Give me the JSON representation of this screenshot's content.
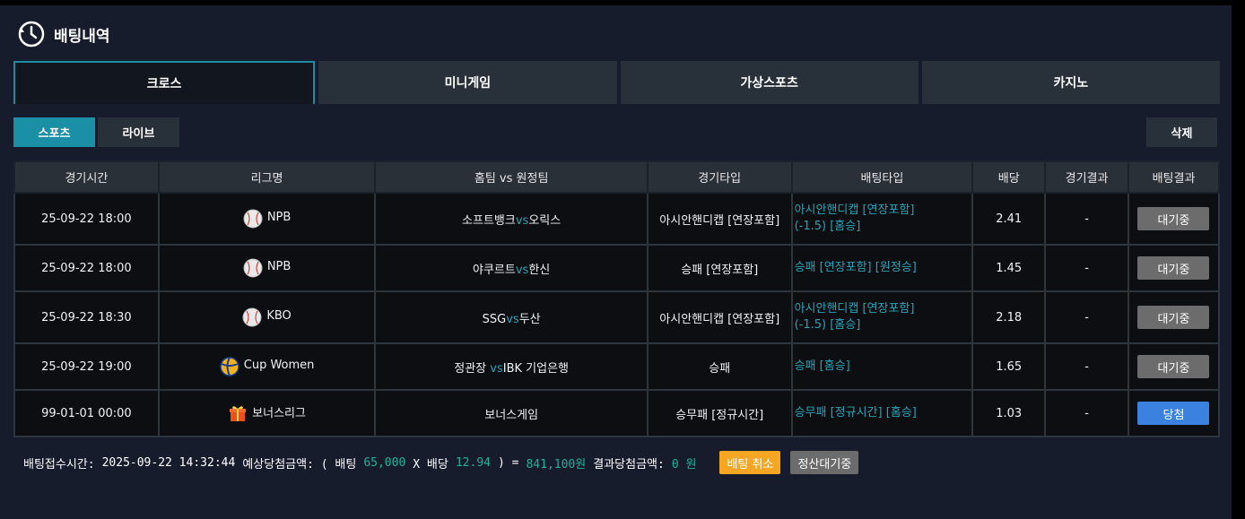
{
  "header": {
    "title": "배팅내역",
    "icon": "history-clock-icon"
  },
  "tabs": [
    {
      "label": "크로스",
      "active": true
    },
    {
      "label": "미니게임",
      "active": false
    },
    {
      "label": "가상스포츠",
      "active": false
    },
    {
      "label": "카지노",
      "active": false
    }
  ],
  "subtabs": [
    {
      "label": "스포츠",
      "active": true
    },
    {
      "label": "라이브",
      "active": false
    }
  ],
  "delete_label": "삭제",
  "columns": [
    "경기시간",
    "리그명",
    "홈팀 vs 원정팀",
    "경기타입",
    "배팅타입",
    "배당",
    "경기결과",
    "배팅결과"
  ],
  "rows": [
    {
      "time": "25-09-22 18:00",
      "league_icon": "baseball-icon",
      "league": "NPB",
      "home": "소프트뱅크",
      "vs": "vs",
      "away": "오릭스",
      "game_type": "아시안핸디캡 [연장포함]",
      "bet_type_1": "아시안핸디캡 [연장포함]",
      "bet_type_2": "(-1.5) [홈승]",
      "odds": "2.41",
      "result": "-",
      "status": "대기중"
    },
    {
      "time": "25-09-22 18:00",
      "league_icon": "baseball-icon",
      "league": "NPB",
      "home": "야쿠르트",
      "vs": "vs",
      "away": "한신",
      "game_type": "승패 [연장포함]",
      "bet_type_1": "승패 [연장포함] [원정승]",
      "bet_type_2": "",
      "odds": "1.45",
      "result": "-",
      "status": "대기중"
    },
    {
      "time": "25-09-22 18:30",
      "league_icon": "baseball-icon",
      "league": "KBO",
      "home": "SSG",
      "vs": "vs",
      "away": "두산",
      "game_type": "아시안핸디캡 [연장포함]",
      "bet_type_1": "아시안핸디캡 [연장포함]",
      "bet_type_2": "(-1.5) [홈승]",
      "odds": "2.18",
      "result": "-",
      "status": "대기중"
    },
    {
      "time": "25-09-22 19:00",
      "league_icon": "volleyball-icon",
      "league": "Cup Women",
      "home": "정관장",
      "vs": "vs",
      "away": "IBK 기업은행",
      "game_type": "승패",
      "bet_type_1": "승패 [홈승]",
      "bet_type_2": "",
      "odds": "1.65",
      "result": "-",
      "status": "대기중"
    },
    {
      "time": "99-01-01 00:00",
      "league_icon": "gift-icon",
      "league": "보너스리그",
      "home": "보너스게임",
      "vs": "",
      "away": "",
      "game_type": "승무패 [정규시간]",
      "bet_type_1": "승무패 [정규시간] [홈승]",
      "bet_type_2": "",
      "odds": "1.03",
      "result": "-",
      "status": "당첨"
    }
  ],
  "footer": {
    "time_label": "배팅접수시간:",
    "time_value": "2025-09-22 14:32:44",
    "expected_label": "예상당첨금액: ( 배팅",
    "bet_amount": "65,000",
    "x_label": "X 배당",
    "total_odds": "12.94",
    "eq_label": ") =",
    "expected_amount": "841,100원",
    "result_label": "결과당첨금액:",
    "result_amount": "0 원",
    "cancel_label": "배팅 취소",
    "settle_label": "정산대기중"
  },
  "colors": {
    "accent": "#1a8fa5",
    "teal_text": "#2aa3b8",
    "win": "#3b82e0",
    "cancel": "#f5a623"
  }
}
